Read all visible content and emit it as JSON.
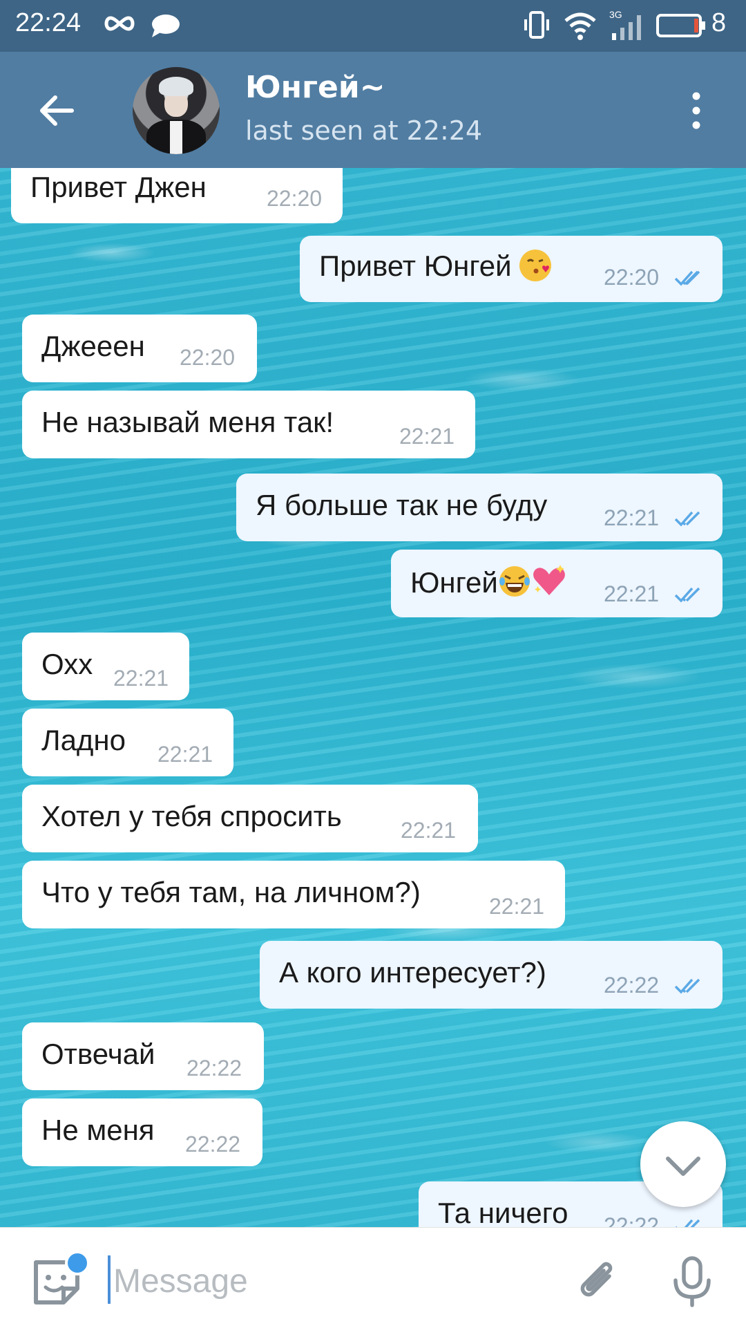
{
  "status_bar": {
    "time": "22:24",
    "network": "3G",
    "battery_level": "8"
  },
  "header": {
    "contact_name": "Юнгей~",
    "contact_status": "last seen at 22:24"
  },
  "messages": [
    {
      "direction": "in",
      "text": "Привет Джен",
      "time": "22:20"
    },
    {
      "direction": "out",
      "text": "Привет Юнгей",
      "emoji": "kissing-face-emoji",
      "time": "22:20",
      "read": true
    },
    {
      "direction": "in",
      "text": "Джееен",
      "time": "22:20"
    },
    {
      "direction": "in",
      "text": "Не называй меня так!",
      "time": "22:21"
    },
    {
      "direction": "out",
      "text": "Я больше так не буду",
      "time": "22:21",
      "read": true
    },
    {
      "direction": "out",
      "text": "Юнгей",
      "emoji": "laughing-face-and-sparkling-heart-emoji",
      "time": "22:21",
      "read": true
    },
    {
      "direction": "in",
      "text": "Охх",
      "time": "22:21"
    },
    {
      "direction": "in",
      "text": "Ладно",
      "time": "22:21"
    },
    {
      "direction": "in",
      "text": "Хотел у тебя спросить",
      "time": "22:21"
    },
    {
      "direction": "in",
      "text": "Что у тебя там, на личном?)",
      "time": "22:21"
    },
    {
      "direction": "out",
      "text": "А кого интересует?)",
      "time": "22:22",
      "read": true
    },
    {
      "direction": "in",
      "text": "Отвечай",
      "time": "22:22"
    },
    {
      "direction": "in",
      "text": "Не меня",
      "time": "22:22"
    },
    {
      "direction": "out",
      "text": "Та ничего",
      "time": "22:22",
      "read": true
    }
  ],
  "input": {
    "placeholder": "Message"
  },
  "colors": {
    "header_bg": "#517da2",
    "status_bar_bg": "#3e6586",
    "incoming_bubble": "#ffffff",
    "outgoing_bubble": "#eef6ff",
    "read_ticks": "#5aa9e6",
    "accent": "#3e9be9"
  }
}
